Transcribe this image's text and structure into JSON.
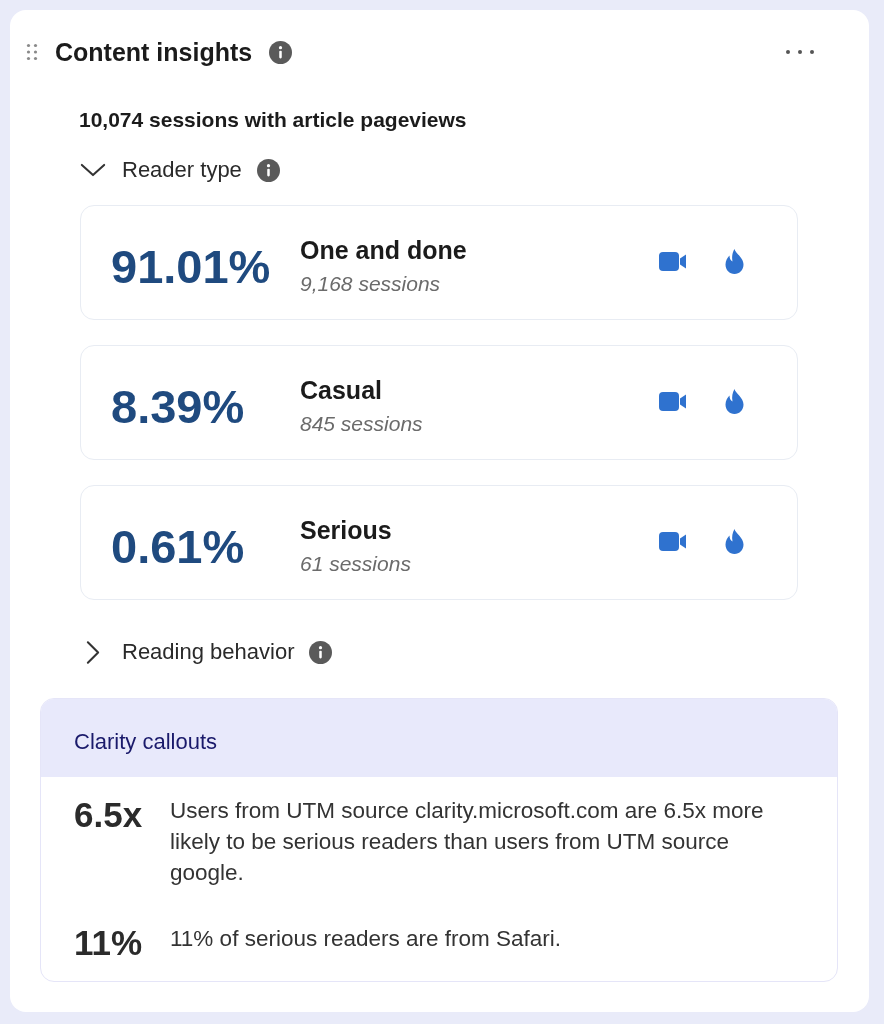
{
  "widget": {
    "title": "Content insights",
    "summary": "10,074 sessions with article pageviews"
  },
  "sections": [
    {
      "label": "Reader type",
      "expanded": true,
      "cards": [
        {
          "percent": "91.01%",
          "label": "One and done",
          "sessions": "9,168 sessions"
        },
        {
          "percent": "8.39%",
          "label": "Casual",
          "sessions": "845 sessions"
        },
        {
          "percent": "0.61%",
          "label": "Serious",
          "sessions": "61 sessions"
        }
      ]
    },
    {
      "label": "Reading behavior",
      "expanded": false
    }
  ],
  "callouts": {
    "title": "Clarity callouts",
    "items": [
      {
        "value": "6.5x",
        "text": "Users from UTM source clarity.microsoft.com are 6.5x more likely to be serious readers than users from UTM source google."
      },
      {
        "value": "11%",
        "text": "11% of serious readers are from Safari."
      }
    ]
  }
}
